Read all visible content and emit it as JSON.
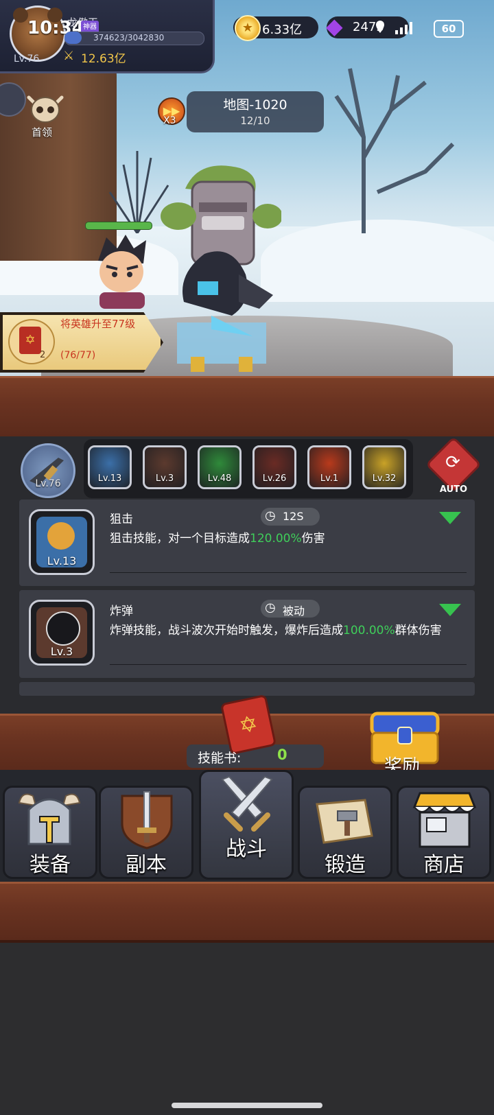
{
  "status_bar": {
    "time": "10:34",
    "battery": "60"
  },
  "player": {
    "name": "龙傲天",
    "vip_badge": "神器",
    "level": "Lv.76",
    "exp_text": "374623/3042830",
    "exp_fraction": 0.123,
    "power": "12.63亿"
  },
  "currency": {
    "gold": "6.33亿",
    "gems": "2473"
  },
  "map": {
    "name": "地图-1020",
    "progress": "12/10",
    "speed": "X3"
  },
  "boss": {
    "label": "首领"
  },
  "hero": {
    "hp_fraction": 1.0
  },
  "quest": {
    "title": "将英雄升至77级",
    "count": "2",
    "progress": "(76/77)"
  },
  "weapon": {
    "level": "Lv.76"
  },
  "skill_slots": [
    {
      "level": "Lv.13",
      "color": "#3b6fa8"
    },
    {
      "level": "Lv.3",
      "color": "#5c3a2e"
    },
    {
      "level": "Lv.48",
      "color": "#2f8a3a"
    },
    {
      "level": "Lv.26",
      "color": "#6a2b24"
    },
    {
      "level": "Lv.1",
      "color": "#b83a1c"
    },
    {
      "level": "Lv.32",
      "color": "#c9a227"
    }
  ],
  "auto_label": "AUTO",
  "skills": [
    {
      "name": "狙击",
      "level": "Lv.13",
      "cooldown": "12S",
      "desc_before": "狙击技能，对一个目标造成",
      "desc_highlight": "120.00%",
      "desc_after": "伤害"
    },
    {
      "name": "炸弹",
      "level": "Lv.3",
      "cooldown": "被动",
      "desc_before": "炸弹技能，战斗波次开始时触发，爆炸后造成",
      "desc_highlight": "100.00%",
      "desc_after": "群体伤害"
    }
  ],
  "skill_book": {
    "label": "技能书:",
    "count": "0"
  },
  "reward": {
    "label": "奖励"
  },
  "nav": {
    "equip": "装备",
    "dungeon": "副本",
    "battle": "战斗",
    "forge": "锻造",
    "shop": "商店"
  }
}
